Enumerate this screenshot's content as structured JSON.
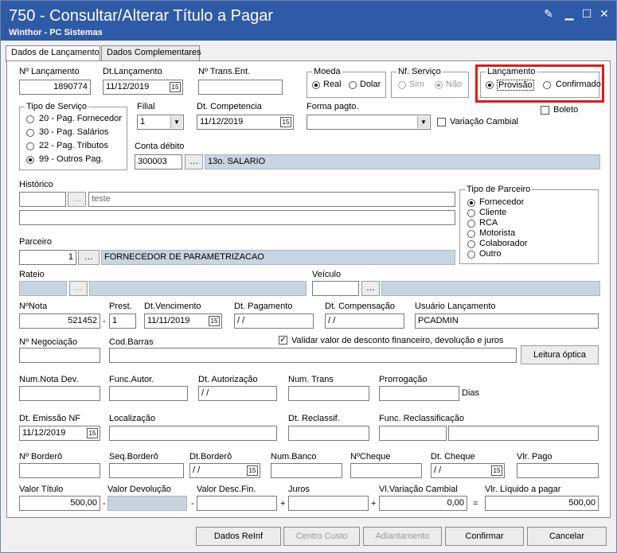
{
  "window": {
    "title": "750 - Consultar/Alterar Título a Pagar",
    "subtitle": "Winthor - PC Sistemas"
  },
  "tabs": [
    "Dados de Lançamento",
    "Dados Complementares"
  ],
  "row1": {
    "num_lancamento_label": "Nº Lançamento",
    "num_lancamento_value": "1890774",
    "dt_lancamento_label": "Dt.Lançamento",
    "dt_lancamento_value": "11/12/2019",
    "trans_ent_label": "Nº Trans.Ent.",
    "trans_ent_value": "",
    "moeda_label": "Moeda",
    "moeda_real": "Real",
    "moeda_dolar": "Dolar",
    "nf_servico_label": "Nf. Serviço",
    "nf_sim": "Sim",
    "nf_nao": "Não",
    "lancamento_label": "Lançamento",
    "lanc_provisao": "Provisão",
    "lanc_confirmado": "Confirmado",
    "boleto_label": "Boleto"
  },
  "tipo_servico": {
    "label": "Tipo de Serviço",
    "options": [
      "20 - Pag. Fornecedor",
      "30 - Pag. Salários",
      "22 - Pag. Tributos",
      "99 - Outros Pag."
    ]
  },
  "row2": {
    "filial_label": "Filial",
    "filial_value": "1",
    "dt_competencia_label": "Dt. Competencia",
    "dt_competencia_value": "11/12/2019",
    "forma_pagto_label": "Forma pagto.",
    "forma_pagto_value": "",
    "variacao_cambial_label": "Variação Cambial",
    "conta_debito_label": "Conta débito",
    "conta_debito_value": "300003",
    "conta_debito_desc": "13o. SALARIO"
  },
  "historico": {
    "label": "Histórico",
    "code": "",
    "text": "teste",
    "line2": ""
  },
  "tipo_parceiro": {
    "label": "Tipo de Parceiro",
    "options": [
      "Fornecedor",
      "Cliente",
      "RCA",
      "Motorista",
      "Colaborador",
      "Outro"
    ]
  },
  "parceiro": {
    "label": "Parceiro",
    "code": "1",
    "name": "FORNECEDOR DE PARAMETRIZACAO"
  },
  "rateio_label": "Rateio",
  "veiculo_label": "Veículo",
  "row_nota": {
    "num_nota_label": "NºNota",
    "num_nota_value": "521452",
    "prest_label": "Prest.",
    "prest_value": "1",
    "dt_vencimento_label": "Dt.Vencimento",
    "dt_vencimento_value": "11/11/2019",
    "dt_pagamento_label": "Dt. Pagamento",
    "dt_pagamento_value": " / /",
    "dt_compensacao_label": "Dt. Compensação",
    "dt_compensacao_value": " / /",
    "usuario_label": "Usuário Lançamento",
    "usuario_value": "PCADMIN"
  },
  "row_negoc": {
    "num_negociacao_label": "Nº Negociação",
    "cod_barras_label": "Cod.Barras",
    "validar_label": "Validar valor de desconto financeiro,  devolução e juros",
    "leitura_optica": "Leitura óptica"
  },
  "row_dev": {
    "num_nota_dev_label": "Num.Nota Dev.",
    "func_autor_label": "Func.Autor.",
    "dt_autorizacao_label": "Dt. Autorização",
    "dt_autorizacao_value": " / /",
    "num_trans_label": "Num. Trans",
    "prorrogacao_label": "Prorrogação",
    "dias_label": "Dias"
  },
  "row_emissao": {
    "dt_emissao_label": "Dt. Emissão NF",
    "dt_emissao_value": "11/12/2019",
    "localizacao_label": "Localização",
    "dt_reclassif_label": "Dt. Reclassif.",
    "func_reclass_label": "Func. Reclassificação"
  },
  "row_bordero": {
    "num_bordero_label": "Nº Borderô",
    "seq_bordero_label": "Seq.Borderô",
    "dt_bordero_label": "Dt.Borderô",
    "dt_bordero_value": " / /",
    "num_banco_label": "Num.Banco",
    "num_cheque_label": "NºCheque",
    "dt_cheque_label": "Dt. Cheque",
    "dt_cheque_value": " / /",
    "vlr_pago_label": "Vlr. Pago"
  },
  "row_valores": {
    "valor_titulo_label": "Valor Título",
    "valor_titulo_value": "500,00",
    "valor_devolucao_label": "Valor Devolução",
    "valor_desc_fin_label": "Valor Desc.Fin.",
    "juros_label": "Juros",
    "vl_variacao_label": "Vl.Variação Cambial",
    "vl_variacao_value": "0,00",
    "vlr_liquido_label": "Vlr. Líquido a pagar",
    "vlr_liquido_value": "500,00"
  },
  "footer": {
    "dados_reinf": "Dados ReInf",
    "centro_custo": "Centro Custo",
    "adiantamento": "Adiantamento",
    "confirmar": "Confirmar",
    "cancelar": "Cancelar"
  }
}
